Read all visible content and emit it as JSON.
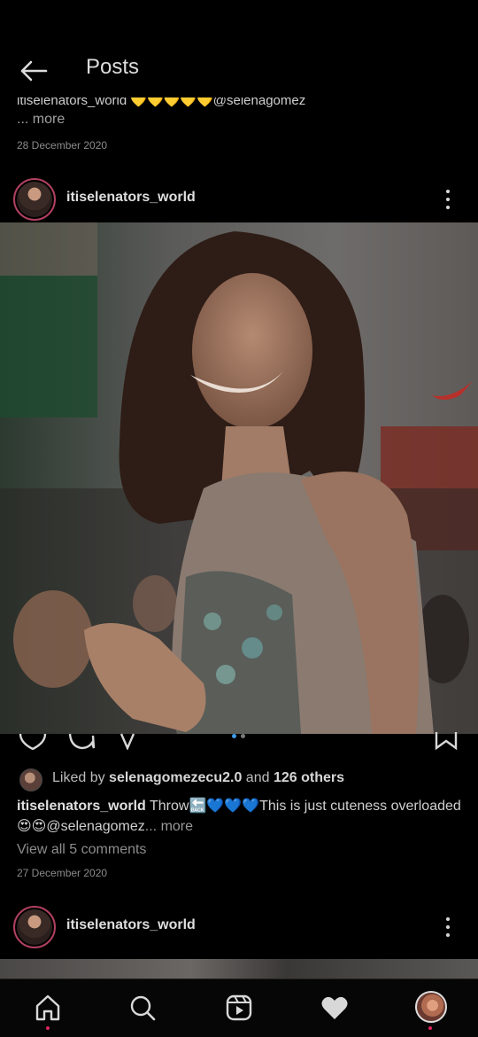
{
  "header": {
    "title": "Posts"
  },
  "previous_post": {
    "caption": "itiselenators_world 💛💛💛💛💛@selenagomez",
    "more_label": "... more",
    "date": "28 December 2020"
  },
  "post": {
    "username": "itiselenators_world",
    "photo_alt": "photo",
    "carousel": {
      "total": 2,
      "active": 1
    },
    "likes": {
      "prefix": "Liked by",
      "liker": "selenagomezecu2.0",
      "joiner": "and",
      "others": "126 others"
    },
    "caption": {
      "username": "itiselenators_world",
      "text": "Throw🔙💙💙💙This is just cuteness overloaded 😍😍@selenagomez",
      "more_label": "... more"
    },
    "comments_label": "View all 5 comments",
    "date": "27 December 2020"
  },
  "next_post": {
    "username": "itiselenators_world"
  },
  "icons": {
    "back": "arrow-left-icon",
    "more": "more-vertical-icon",
    "like": "heart-outline-icon",
    "comment": "comment-icon",
    "share": "send-icon",
    "save": "bookmark-icon",
    "home": "home-icon",
    "search": "search-icon",
    "reels": "reels-icon",
    "activity": "heart-filled-icon",
    "profile": "profile-avatar"
  },
  "colors": {
    "accent_dot": "#e0245e",
    "carousel_active": "#3d9be9"
  }
}
